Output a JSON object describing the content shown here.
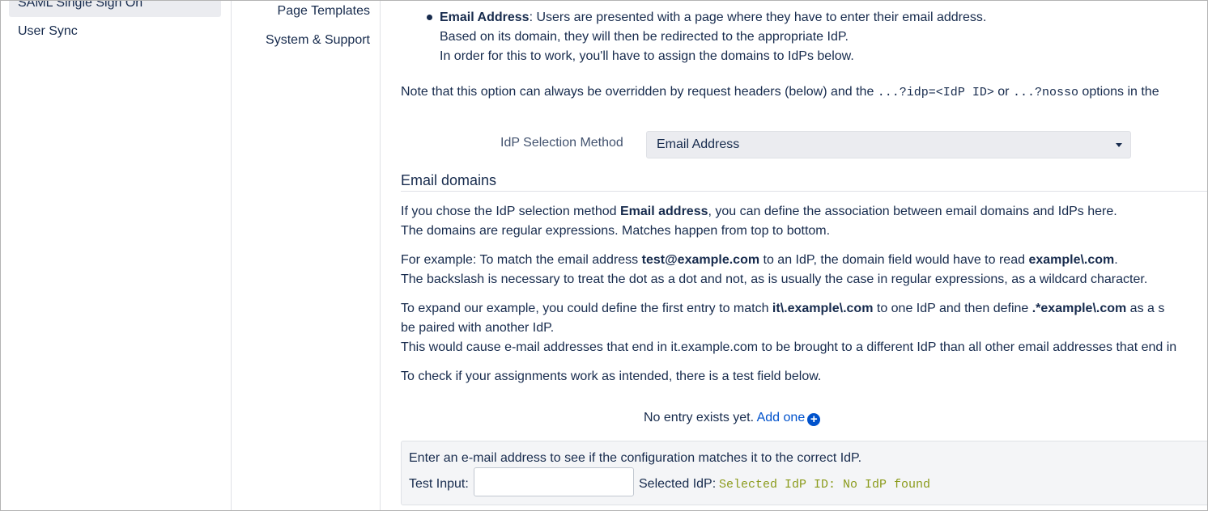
{
  "sidebar": {
    "items": [
      {
        "label": "SAML Single Sign On",
        "active": true
      },
      {
        "label": "User Sync",
        "active": false
      }
    ]
  },
  "subnav": {
    "items": [
      {
        "label": "Page Templates"
      },
      {
        "label": "System & Support"
      }
    ]
  },
  "bullet": {
    "title": "Email Address",
    "line1_rest": ": Users are presented with a page where they have to enter their email address.",
    "line2": "Based on its domain, they will then be redirected to the appropriate IdP.",
    "line3": "In order for this to work, you'll have to assign the domains to IdPs below."
  },
  "note": {
    "prefix": "Note that this option can always be overridden by request headers (below) and the ",
    "code1": "...?idp=<IdP ID>",
    "middle": " or ",
    "code2": "...?nosso",
    "suffix": " options in the"
  },
  "idp_selection": {
    "label": "IdP Selection Method",
    "value": "Email Address"
  },
  "email_domains": {
    "title": "Email domains",
    "p1_a": "If you chose the IdP selection method ",
    "p1_b": "Email address",
    "p1_c": ", you can define the association between email domains and IdPs here.",
    "p1_line2": "The domains are regular expressions. Matches happen from top to bottom.",
    "p2_a": "For example: To match the email address ",
    "p2_b": "test@example.com",
    "p2_c": " to an IdP, the domain field would have to read ",
    "p2_d": "example\\.com",
    "p2_e": ".",
    "p2_line2": "The backslash is necessary to treat the dot as a dot and not, as is usually the case in regular expressions, as a wildcard character.",
    "p3_a": "To expand our example, you could define the first entry to match ",
    "p3_b": "it\\.example\\.com",
    "p3_c": " to one IdP and then define ",
    "p3_d": ".*example\\.com",
    "p3_e": " as a s",
    "p3_line2": "be paired with another IdP.",
    "p3_line3": "This would cause e-mail addresses that end in it.example.com to be brought to a different IdP than all other email addresses that end in",
    "p4": "To check if your assignments work as intended, there is a test field below.",
    "empty_text": "No entry exists yet. ",
    "add_link": "Add one"
  },
  "test": {
    "intro": "Enter an e-mail address to see if the configuration matches it to the correct IdP.",
    "input_label": "Test Input:",
    "input_value": "",
    "selected_label": "Selected IdP:",
    "selected_value": "Selected IdP ID: No IdP found"
  },
  "colors": {
    "link": "#0052cc",
    "result_text": "#8b9b1c",
    "active_bg": "#ebecf0"
  }
}
